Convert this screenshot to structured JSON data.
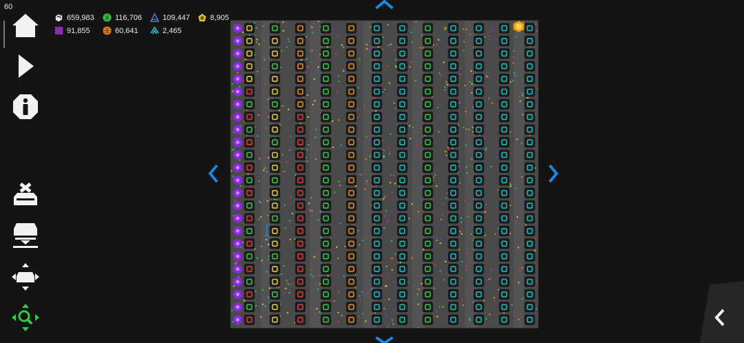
{
  "hud": {
    "fps": "60",
    "resources": [
      {
        "name": "coins-icon",
        "value": "659,983",
        "color": "#e8e8e8"
      },
      {
        "name": "green-leaf-icon",
        "value": "116,706",
        "color": "#3cc24a"
      },
      {
        "name": "blue-triangle-icon",
        "value": "109,447",
        "color": "#5a78e0"
      },
      {
        "name": "gold-pentagon-icon",
        "value": "8,905",
        "color": "#e2c43a"
      },
      {
        "name": "purple-stripes-icon",
        "value": "91,855",
        "color": "#b040d8"
      },
      {
        "name": "orange-ball-icon",
        "value": "60,641",
        "color": "#e88a2a"
      },
      {
        "name": "cyan-chevron-icon",
        "value": "2,465",
        "color": "#2ac4c8"
      }
    ]
  },
  "sidebar": {
    "buttons": [
      {
        "name": "home-icon"
      },
      {
        "name": "play-icon"
      },
      {
        "name": "info-icon"
      },
      {
        "name": "clear-inbox-icon"
      },
      {
        "name": "import-tray-icon"
      },
      {
        "name": "move-tool-icon"
      },
      {
        "name": "zoom-select-icon"
      }
    ]
  },
  "navigation": {
    "arrows": [
      "arrow-up-icon",
      "arrow-down-icon",
      "arrow-left-icon",
      "arrow-right-icon"
    ],
    "arrow_color": "#1c86e0",
    "collapse": "chevron-left-icon"
  },
  "board": {
    "background": "#4a4a4a",
    "rows": 24,
    "column_types": [
      "purple",
      "red_yellow",
      "yellow_green",
      "orange_red",
      "green",
      "orange",
      "teal",
      "teal",
      "green",
      "teal",
      "teal",
      "teal",
      "teal",
      "teal",
      "teal"
    ],
    "colors": {
      "purple": "#8a2be2",
      "yellow": "#e8c83a",
      "red": "#e23a3a",
      "green": "#3cc24a",
      "orange": "#e8892a",
      "teal": "#23b8c0",
      "gold": "#e6a520"
    }
  }
}
